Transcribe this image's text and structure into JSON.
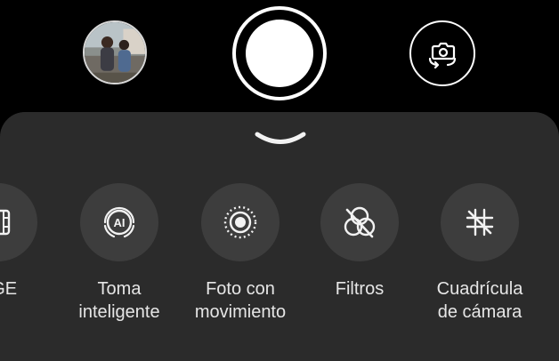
{
  "camera": {
    "thumbnail_alt": "Última foto",
    "accent_color": "#ffffff",
    "panel_color": "#2b2b2b"
  },
  "options": [
    {
      "id": "partial",
      "label": "AGE",
      "icon": "film-icon"
    },
    {
      "id": "smart",
      "label": "Toma\ninteligente",
      "icon": "ai-icon"
    },
    {
      "id": "motion",
      "label": "Foto con\nmovimiento",
      "icon": "motion-photo-icon"
    },
    {
      "id": "filters",
      "label": "Filtros",
      "icon": "filters-icon"
    },
    {
      "id": "grid",
      "label": "Cuadrícula\nde cámara",
      "icon": "grid-icon"
    }
  ]
}
